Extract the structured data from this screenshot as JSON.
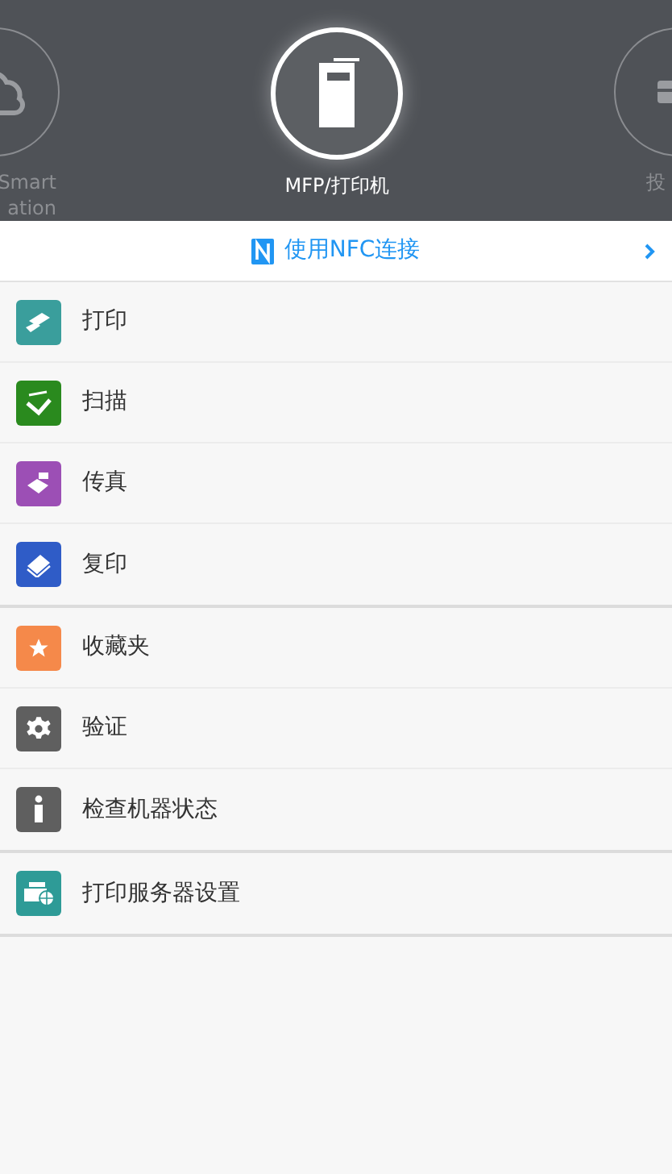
{
  "carousel": [
    {
      "label_lines": [
        "Smart",
        "ation"
      ],
      "selected": false
    },
    {
      "label_lines": [
        "MFP/打印机"
      ],
      "selected": true
    },
    {
      "label_lines": [
        "投"
      ],
      "selected": false
    }
  ],
  "nfc": {
    "label": "使用NFC连接"
  },
  "groups": [
    [
      {
        "label": "打印",
        "color": "#3a9e9c"
      },
      {
        "label": "扫描",
        "color": "#2a8a1e"
      },
      {
        "label": "传真",
        "color": "#9c4fb5"
      },
      {
        "label": "复印",
        "color": "#2f5cc7"
      }
    ],
    [
      {
        "label": "收藏夹",
        "color": "#f5894a"
      },
      {
        "label": "验证",
        "color": "#5f5f5f"
      },
      {
        "label": "检查机器状态",
        "color": "#5f5f5f"
      }
    ],
    [
      {
        "label": "打印服务器设置",
        "color": "#2e9b97"
      }
    ]
  ]
}
